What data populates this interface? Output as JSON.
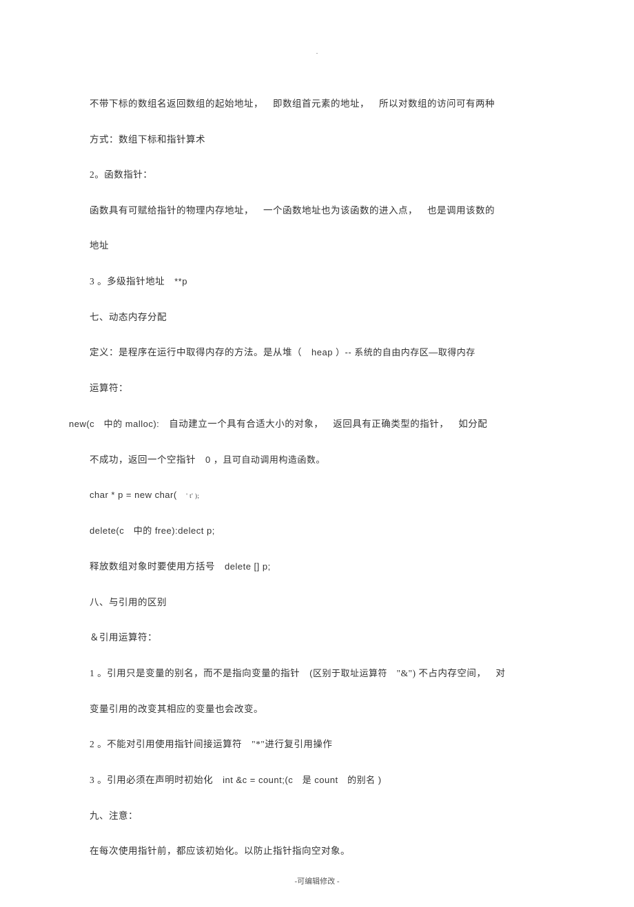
{
  "top_marker": ".",
  "paragraphs": {
    "p1": "不带下标的数组名返回数组的起始地址， 即数组首元素的地址， 所以对数组的访问可有两种",
    "p2": "方式：数组下标和指针算术",
    "p3": "2。函数指针：",
    "p4": "函数具有可赋给指针的物理内存地址， 一个函数地址也为该函数的进入点， 也是调用该数的",
    "p5": "地址",
    "p6_a": "3 。多级指针地址 ",
    "p6_b": "**p",
    "p7": "七、动态内存分配",
    "p8_a": "定义：是程序在运行中取得内存的方法。是从堆（ ",
    "p8_b": "heap ）-- 系统的自由内存区—取得内存",
    "p9": "运算符：",
    "p10_a": "new(c 中的 malloc):",
    "p10_b": " 自动建立一个具有合适大小的对象， 返回具有正确类型的指针， 如分配",
    "p11_a": "不成功，返回一个空指针 ",
    "p11_b": "0 ，且可自动调用构造函数。",
    "p12_a": "char * p = new char( ",
    "p12_b": "' t' );",
    "p13_a": "delete(c 中的 free):delect p;",
    "p14_a": "释放数组对象时要使用方括号 ",
    "p14_b": "delete [] p;",
    "p15": "八、与引用的区别",
    "p16": "＆引用运算符：",
    "p17_a": "1 。引用只是变量的别名，而不是指向变量的指针 ",
    "p17_b": "(区别于取址运算符 ",
    "p17_c": "\"&\") 不占内存空间， 对",
    "p18": "变量引用的改变其相应的变量也会改变。",
    "p19_a": "2 。不能对引用使用指针间接运算符 ",
    "p19_b": "\"*\"进行复引用操作",
    "p20_a": "3 。引用必须在声明时初始化 ",
    "p20_b": "int &c = count;(c 是 count 的别名 )",
    "p21": "九、注意：",
    "p22": "在每次使用指针前，都应该初始化。以防止指针指向空对象。"
  },
  "footer": "-可编辑修改 -"
}
